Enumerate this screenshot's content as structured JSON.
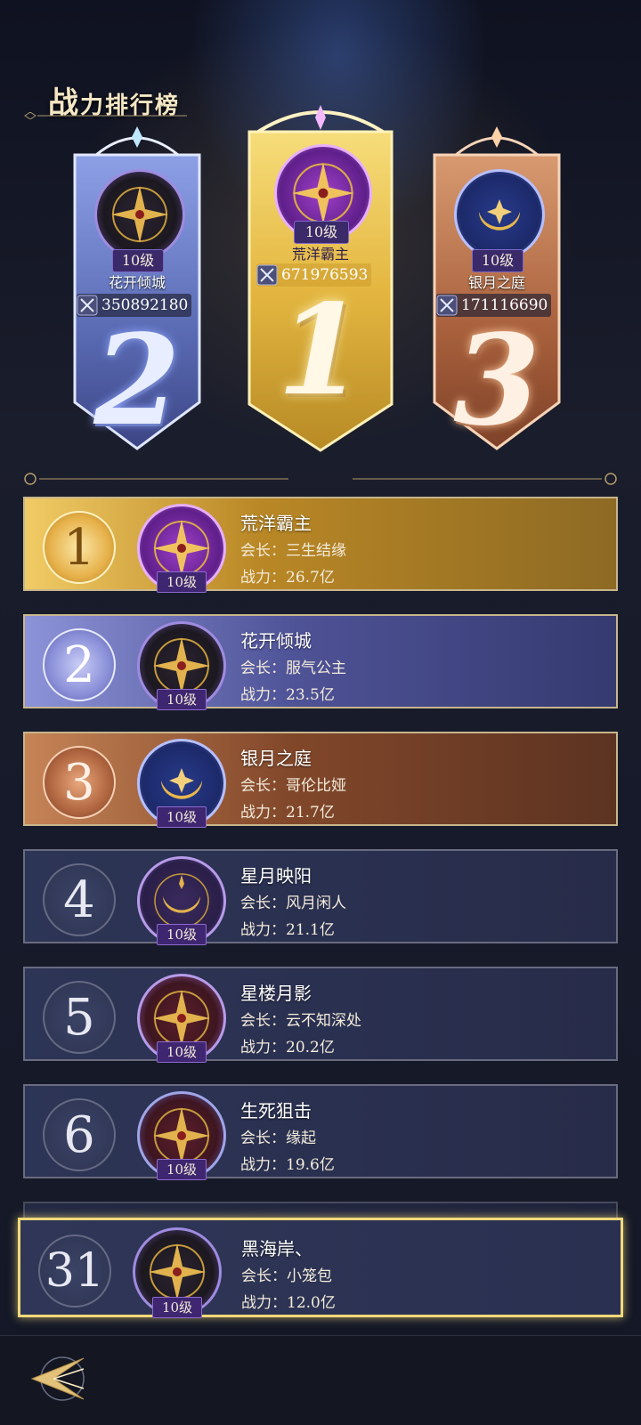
{
  "header": {
    "title_big": "战",
    "title_rest": "力排行榜"
  },
  "podium": [
    {
      "rank": "2",
      "level": "10级",
      "name": "花开倾城",
      "power": "350892180"
    },
    {
      "rank": "1",
      "level": "10级",
      "name": "荒洋霸主",
      "power": "671976593"
    },
    {
      "rank": "3",
      "level": "10级",
      "name": "银月之庭",
      "power": "171116690"
    }
  ],
  "list": [
    {
      "rank": "1",
      "name": "荒洋霸主",
      "leader": "会长：三生结缘",
      "power": "战力：26.7亿",
      "level": "10级",
      "style": "gold"
    },
    {
      "rank": "2",
      "name": "花开倾城",
      "leader": "会长：服气公主",
      "power": "战力：23.5亿",
      "level": "10级",
      "style": "silver"
    },
    {
      "rank": "3",
      "name": "银月之庭",
      "leader": "会长：哥伦比娅",
      "power": "战力：21.7亿",
      "level": "10级",
      "style": "bronze"
    },
    {
      "rank": "4",
      "name": "星月映阳",
      "leader": "会长：风月闲人",
      "power": "战力：21.1亿",
      "level": "10级",
      "style": "normal"
    },
    {
      "rank": "5",
      "name": "星楼月影",
      "leader": "会长：云不知深处",
      "power": "战力：20.2亿",
      "level": "10级",
      "style": "normal"
    },
    {
      "rank": "6",
      "name": "生死狙击",
      "leader": "会长：缘起",
      "power": "战力：19.6亿",
      "level": "10级",
      "style": "normal"
    }
  ],
  "my_rank": {
    "rank": "31",
    "name": "黑海岸、",
    "leader": "会长：小笼包",
    "power": "战力：12.0亿",
    "level": "10级"
  },
  "colors": {
    "gold": "#e6b14a",
    "silver": "#8a8fd8",
    "bronze": "#b06640",
    "highlight": "#f2d97a"
  },
  "icons": {
    "back": "back-arrow-icon",
    "compass": "compass-emblem-icon",
    "moon": "crescent-moon-emblem-icon",
    "power": "crossed-swords-icon"
  }
}
